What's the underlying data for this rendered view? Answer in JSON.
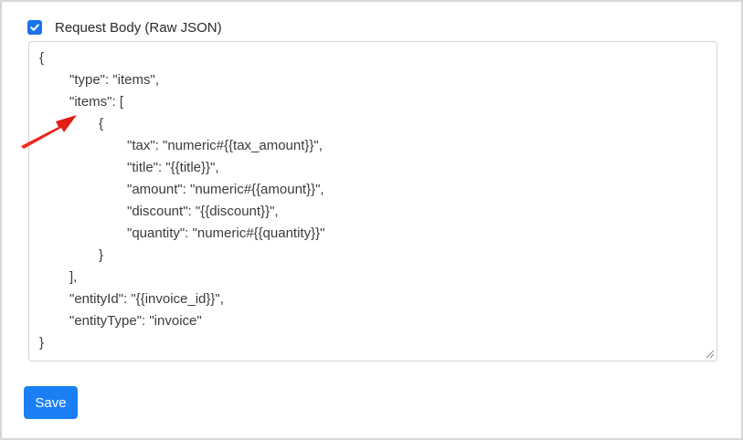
{
  "request_body": {
    "checkbox_checked": true,
    "label": "Request Body (Raw JSON)",
    "lines": [
      "{",
      "\"type\": \"items\",",
      "\"items\": [",
      "{",
      "\"tax\": \"numeric#{{tax_amount}}\",",
      "\"title\": \"{{title}}\",",
      "\"amount\": \"numeric#{{amount}}\",",
      "\"discount\": \"{{discount}}\",",
      "\"quantity\": \"numeric#{{quantity}}\"",
      "}",
      "],",
      "\"entityId\": \"{{invoice_id}}\",",
      "\"entityType\": \"invoice\"",
      "}"
    ]
  },
  "actions": {
    "save_label": "Save"
  },
  "colors": {
    "accent": "#1a7ff5",
    "arrow": "#e8231f"
  }
}
